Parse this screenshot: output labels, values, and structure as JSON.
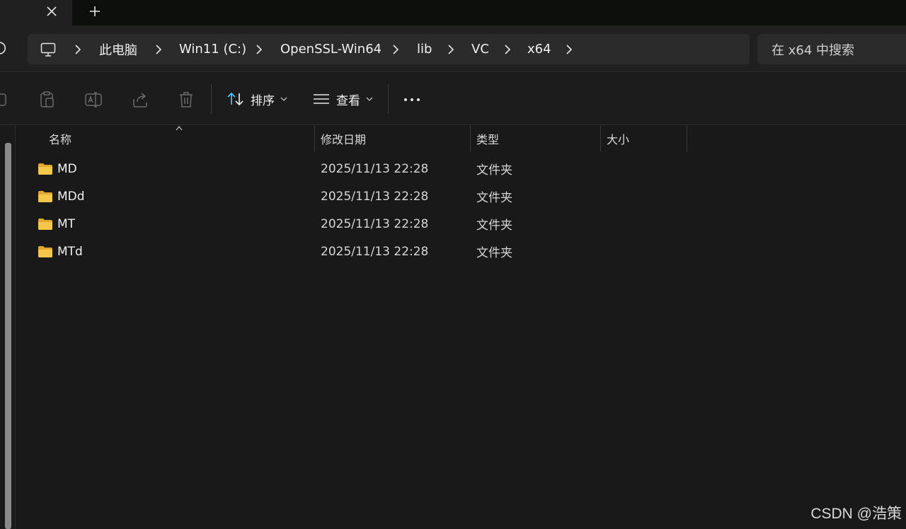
{
  "tabs": {
    "close_label": "close tab",
    "new_label": "new tab"
  },
  "breadcrumb": [
    "此电脑",
    "Win11 (C:)",
    "OpenSSL-Win64",
    "lib",
    "VC",
    "x64"
  ],
  "search": {
    "placeholder": "在 x64 中搜索"
  },
  "commands": {
    "sort_label": "排序",
    "view_label": "查看"
  },
  "columns": {
    "name": "名称",
    "date": "修改日期",
    "type": "类型",
    "size": "大小"
  },
  "files": [
    {
      "name": "MD",
      "date": "2025/11/13 22:28",
      "type": "文件夹"
    },
    {
      "name": "MDd",
      "date": "2025/11/13 22:28",
      "type": "文件夹"
    },
    {
      "name": "MT",
      "date": "2025/11/13 22:28",
      "type": "文件夹"
    },
    {
      "name": "MTd",
      "date": "2025/11/13 22:28",
      "type": "文件夹"
    }
  ],
  "watermark": "CSDN @浩策",
  "colors": {
    "accent": "#4cc2ff",
    "folder": "#f4c64a",
    "background": "#191919"
  }
}
